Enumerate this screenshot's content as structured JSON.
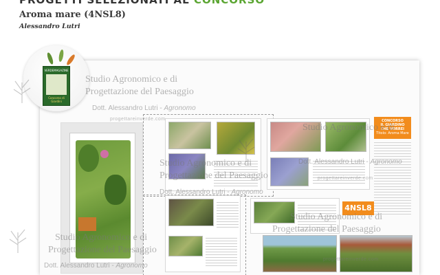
{
  "banner": {
    "text_prefix": "PROGETTI SELEZIONATI AL",
    "text_accent": "CONCORSO"
  },
  "project": {
    "title": "Aroma mare (4NSL8)",
    "author": "Alessandro Lutri"
  },
  "board": {
    "badge_lines": [
      "CONCORSO",
      "IL GIARDINO",
      "CHE VORREI",
      "Titolo: Aroma Mare"
    ],
    "code": "4NSL8"
  },
  "book": {
    "title": "VERDEMAGAZINE",
    "subtitle": "Concorso di Giardini"
  },
  "watermark": {
    "studio_line1": "Studio Agronomico e di",
    "studio_line2": "Progettazione del Paesaggio",
    "dott_prefix": "Dott. Alessandro Lutri -",
    "dott_role": "Agronomo",
    "url": "progettareinverde.com"
  },
  "colors": {
    "accent_green": "#5aa531",
    "badge_orange": "#f28c1c"
  },
  "icons": [
    "plant-sketch-icon",
    "book-cover-icon"
  ]
}
